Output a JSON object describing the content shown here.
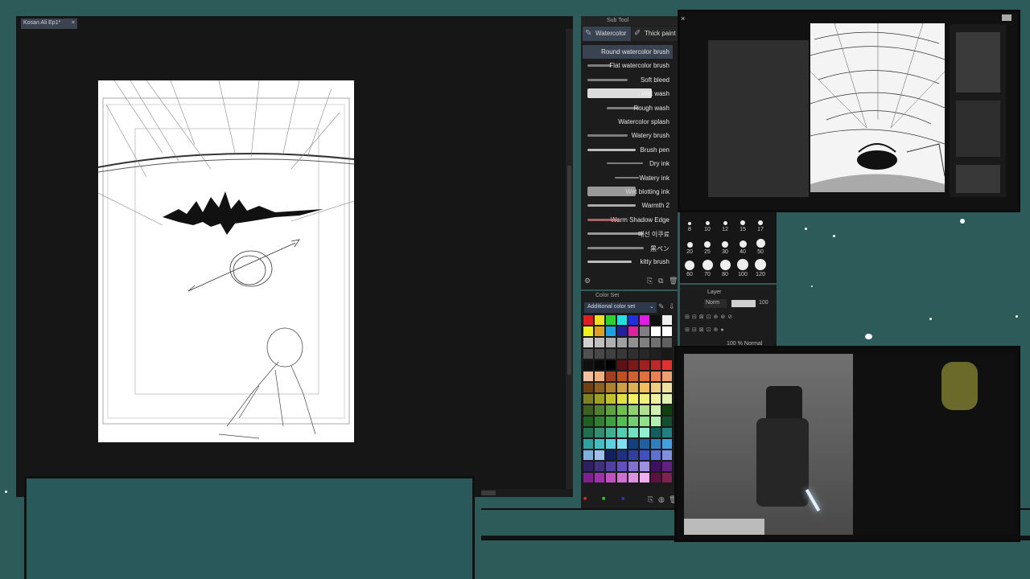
{
  "canvas": {
    "doc_tab": "Kosan Ali Ep1*",
    "close_glyph": "×"
  },
  "subtool": {
    "header": "Sub Tool",
    "tabs": [
      {
        "label": "Watercolor",
        "icon": "brush-icon"
      },
      {
        "label": "Thick paint",
        "icon": "paint-icon"
      }
    ],
    "brushes": [
      "Round watercolor brush",
      "Flat watercolor brush",
      "Soft bleed",
      "Wet wash",
      "Rough wash",
      "Watercolor splash",
      "Watery brush",
      "Brush pen",
      "Dry ink",
      "Watery ink",
      "Wet blotting ink",
      "Warmth 2",
      "Warm Shadow Edge",
      "매선 이쿠료",
      "黒ペン",
      "kitty brush"
    ],
    "selected_index": 0
  },
  "colorset": {
    "header": "Color Set",
    "selected_set": "Additional color set",
    "swatches": [
      "#e02020",
      "#f0e020",
      "#30d030",
      "#20e0e0",
      "#2030e0",
      "#e020e0",
      "#101010",
      "#f0f0f0",
      "#f0f020",
      "#e0a020",
      "#20a0e0",
      "#2020a0",
      "#e020a0",
      "#808080",
      "#ffffff",
      "#ffffff",
      "#d0d0d0",
      "#c0c0c0",
      "#b0b0b0",
      "#a0a0a0",
      "#909090",
      "#808080",
      "#707070",
      "#606060",
      "#505050",
      "#484848",
      "#404040",
      "#383838",
      "#303030",
      "#282828",
      "#202020",
      "#181818",
      "#101010",
      "#080808",
      "#000000",
      "#601010",
      "#801818",
      "#a02020",
      "#c02828",
      "#e03030",
      "#f0c0a0",
      "#f0b080",
      "#a04020",
      "#c05020",
      "#d06030",
      "#e07040",
      "#f08050",
      "#f0a070",
      "#704010",
      "#906020",
      "#b08030",
      "#d0a040",
      "#e0b050",
      "#f0c060",
      "#f0d080",
      "#f0e0a0",
      "#808020",
      "#a0a020",
      "#c0c030",
      "#e0e040",
      "#f0f060",
      "#f0f080",
      "#f0f0a0",
      "#e0f0b0",
      "#406020",
      "#508030",
      "#60a040",
      "#70c050",
      "#90d070",
      "#b0e090",
      "#d0f0b0",
      "#104010",
      "#206020",
      "#308030",
      "#40a040",
      "#50c050",
      "#70d070",
      "#90e090",
      "#b0f0b0",
      "#105030",
      "#207050",
      "#309070",
      "#40b090",
      "#50d0b0",
      "#70e0c0",
      "#90f0d0",
      "#106060",
      "#208080",
      "#30a0a0",
      "#40c0c0",
      "#60d0e0",
      "#80e0f0",
      "#104080",
      "#2060a0",
      "#3080c0",
      "#40a0e0",
      "#80b0e0",
      "#a0c0f0",
      "#102060",
      "#203080",
      "#3040a0",
      "#4050c0",
      "#6070d0",
      "#8090e0",
      "#302060",
      "#403080",
      "#5040a0",
      "#6050c0",
      "#8070d0",
      "#a090e0",
      "#401060",
      "#602080",
      "#802090",
      "#a030b0",
      "#c050c0",
      "#d070d0",
      "#e090e0",
      "#f0b0f0",
      "#601040",
      "#802050"
    ]
  },
  "brush_sizes": {
    "values": [
      "8",
      "10",
      "12",
      "15",
      "17",
      "20",
      "25",
      "30",
      "40",
      "50",
      "60",
      "70",
      "80",
      "100",
      "120"
    ]
  },
  "layer": {
    "header": "Layer",
    "blend_mode": "Norm",
    "opacity": "100",
    "layer_row": "100 % Normal"
  },
  "colors": {
    "background": "#2c5b5a",
    "panel": "#1c1c1c",
    "selected": "#3a4352",
    "canvas_bg": "#161616"
  }
}
